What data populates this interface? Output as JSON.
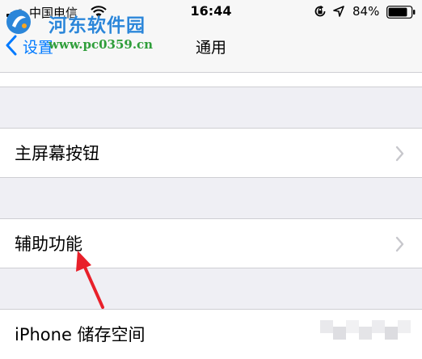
{
  "status_bar": {
    "carrier": "中国电信",
    "time": "16:44",
    "battery_percent": "84%",
    "battery_level": 0.84
  },
  "nav": {
    "back_label": "设置",
    "title": "通用"
  },
  "watermark": {
    "title": "河东软件园",
    "url": "www.pc0359.cn"
  },
  "settings_rows": [
    {
      "label": "主屏幕按钮"
    },
    {
      "label": "辅助功能"
    },
    {
      "label": "iPhone 储存空间"
    }
  ],
  "colors": {
    "accent": "#007aff",
    "annotation_arrow": "#e8202a",
    "background": "#efeff4"
  },
  "icons": [
    "signal-icon",
    "wifi-icon",
    "rotation-lock-icon",
    "location-icon",
    "battery-icon",
    "chevron-left-icon",
    "chevron-right-icon"
  ]
}
